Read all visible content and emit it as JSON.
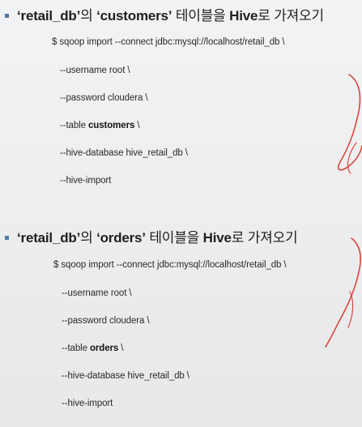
{
  "sections": [
    {
      "heading": {
        "q1": "‘retail_db’",
        "particle": "의 ",
        "q2": "‘customers’",
        "rest_a": " 테이블을 ",
        "hive": "Hive",
        "rest_b": "로 가져오기"
      },
      "command": "$ sqoop import --connect jdbc:mysql://localhost/retail_db \\",
      "options": [
        {
          "prefix": "--username root \\",
          "bold": "",
          "suffix": ""
        },
        {
          "prefix": "--password cloudera \\",
          "bold": "",
          "suffix": ""
        },
        {
          "prefix": "--table ",
          "bold": "customers",
          "suffix": " \\"
        },
        {
          "prefix": "--hive-database hive_retail_db \\",
          "bold": "",
          "suffix": ""
        },
        {
          "prefix": "--hive-import",
          "bold": "",
          "suffix": ""
        }
      ]
    },
    {
      "heading": {
        "q1": "‘retail_db’",
        "particle": "의 ",
        "q2": "‘orders’",
        "rest_a": " 테이블을 ",
        "hive": "Hive",
        "rest_b": "로 가져오기"
      },
      "command": "$ sqoop import --connect jdbc:mysql://localhost/retail_db \\",
      "options": [
        {
          "prefix": "--username root \\",
          "bold": "",
          "suffix": ""
        },
        {
          "prefix": "--password cloudera \\",
          "bold": "",
          "suffix": ""
        },
        {
          "prefix": "--table ",
          "bold": "orders",
          "suffix": " \\"
        },
        {
          "prefix": "--hive-database hive_retail_db \\",
          "bold": "",
          "suffix": ""
        },
        {
          "prefix": "--hive-import",
          "bold": "",
          "suffix": ""
        }
      ]
    }
  ],
  "colors": {
    "bullet": "#4c7ca6",
    "annotation": "#d9463c"
  }
}
